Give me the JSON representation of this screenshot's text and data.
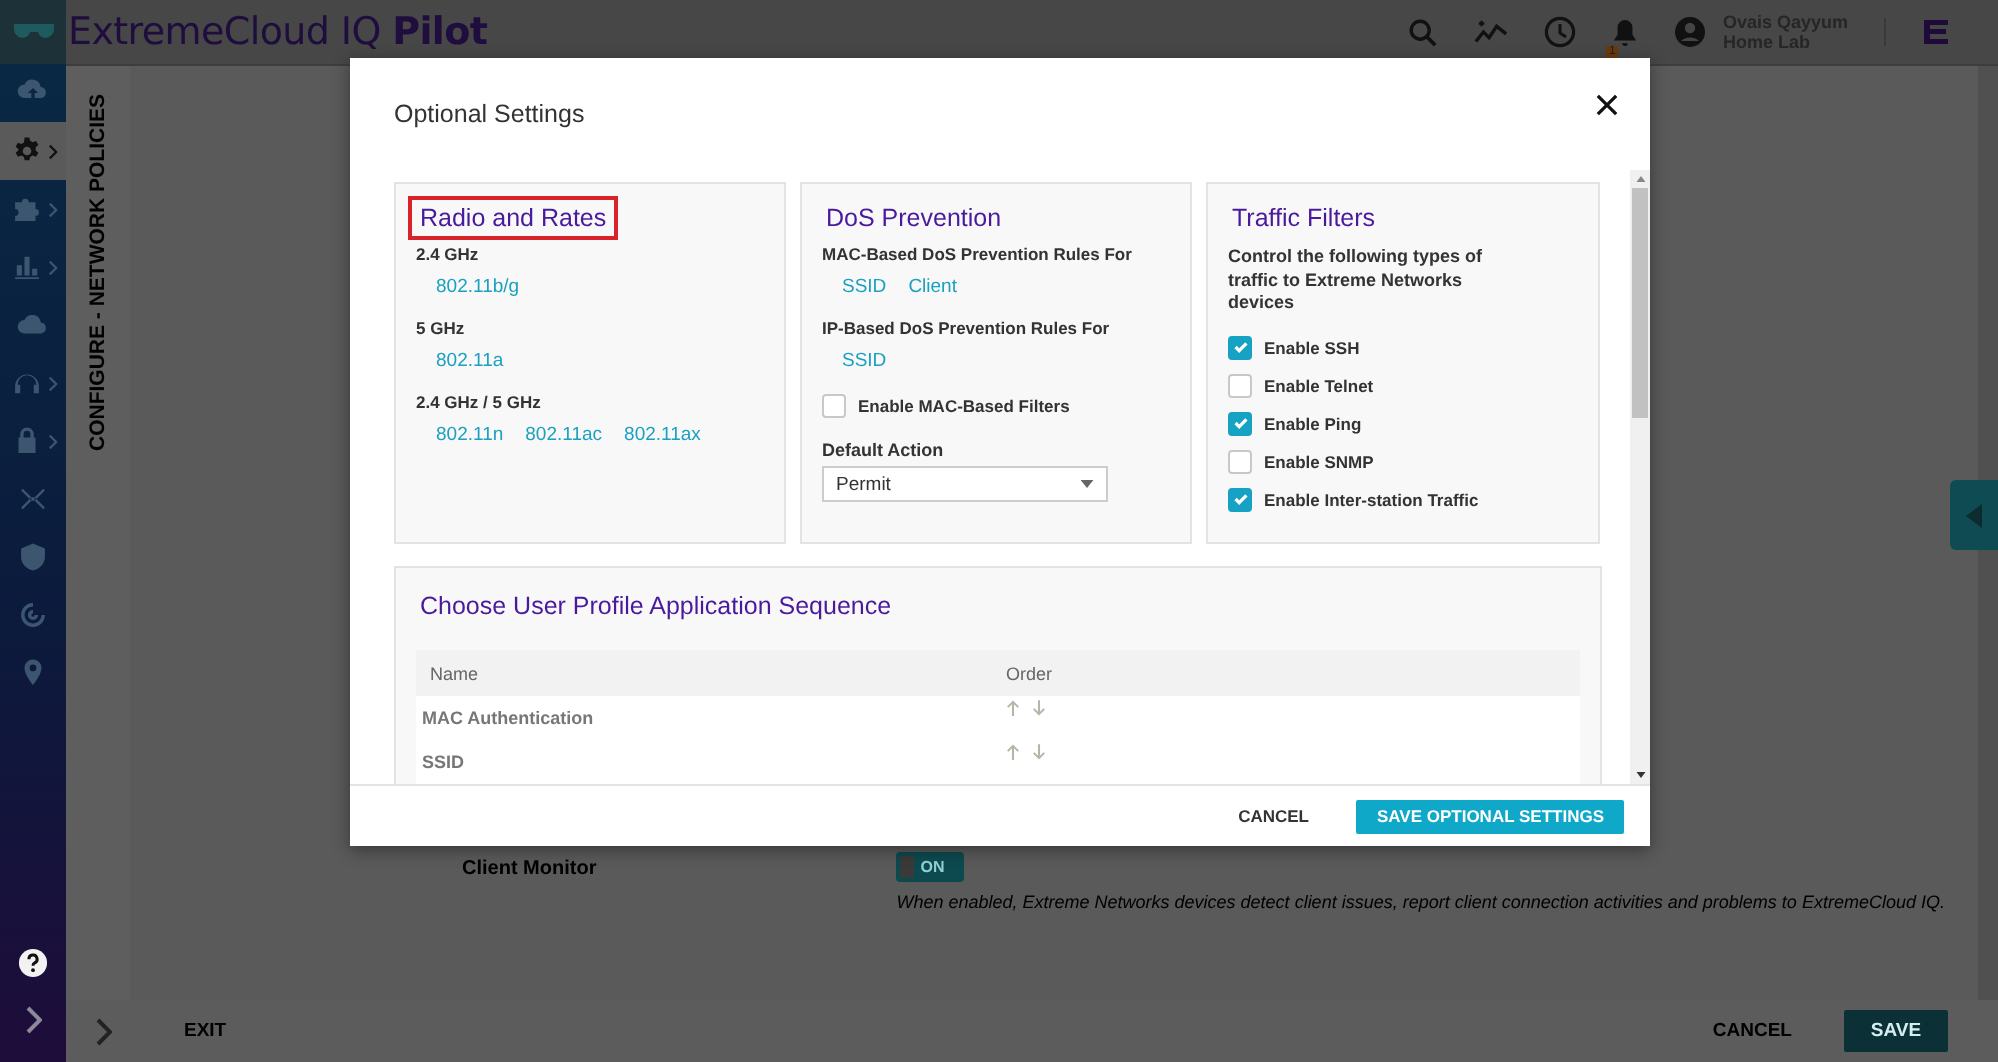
{
  "app": {
    "title": "ExtremeCloud IQ **Pilot**",
    "user": {
      "name": "Ovais Qayyum",
      "org": "Home Lab"
    },
    "notification_count": "1"
  },
  "sidebar": {
    "items": [
      {
        "kind": "cloud-upload",
        "selected": false,
        "submenu": false
      },
      {
        "kind": "gear",
        "selected": true,
        "submenu": true
      },
      {
        "kind": "puzzle",
        "selected": false,
        "submenu": true
      },
      {
        "kind": "chart",
        "selected": false,
        "submenu": true
      },
      {
        "kind": "cloud",
        "selected": false,
        "submenu": false
      },
      {
        "kind": "headset",
        "selected": false,
        "submenu": true
      },
      {
        "kind": "lock",
        "selected": false,
        "submenu": true
      },
      {
        "kind": "network",
        "selected": false,
        "submenu": false
      },
      {
        "kind": "shield",
        "selected": false,
        "submenu": false
      },
      {
        "kind": "radar",
        "selected": false,
        "submenu": false
      },
      {
        "kind": "pin",
        "selected": false,
        "submenu": false
      }
    ]
  },
  "breadcrumb": "CONFIGURE - NETWORK POLICIES",
  "page": {
    "client_monitor": {
      "label": "Client Monitor",
      "toggle": "ON",
      "on": true,
      "hint": "When enabled, Extreme Networks devices detect client issues, report client connection activities and problems to ExtremeCloud IQ."
    },
    "footer": {
      "exit": "EXIT",
      "cancel": "CANCEL",
      "save": "SAVE"
    }
  },
  "dialog": {
    "title": "Optional Settings",
    "radio_rates": {
      "title": "Radio and Rates",
      "highlighted": true,
      "bands": [
        {
          "label": "2.4 GHz",
          "rates": [
            "802.11b/g"
          ]
        },
        {
          "label": "5 GHz",
          "rates": [
            "802.11a"
          ]
        },
        {
          "label": "2.4 GHz / 5 GHz",
          "rates": [
            "802.11n",
            "802.11ac",
            "802.11ax"
          ]
        }
      ]
    },
    "dos": {
      "title": "DoS Prevention",
      "rule_groups": [
        {
          "label": "MAC-Based DoS Prevention Rules For",
          "links": [
            "SSID",
            "Client"
          ]
        },
        {
          "label": "IP-Based DoS Prevention Rules For",
          "links": [
            "SSID"
          ]
        }
      ],
      "mac_filters": {
        "label": "Enable MAC-Based Filters",
        "checked": false
      },
      "default_action": {
        "label": "Default Action",
        "value": "Permit"
      }
    },
    "traffic_filters": {
      "title": "Traffic Filters",
      "description": "Control the following types of traffic to Extreme Networks devices",
      "options": [
        {
          "label": "Enable SSH",
          "checked": true
        },
        {
          "label": "Enable Telnet",
          "checked": false
        },
        {
          "label": "Enable Ping",
          "checked": true
        },
        {
          "label": "Enable SNMP",
          "checked": false
        },
        {
          "label": "Enable Inter-station Traffic",
          "checked": true
        }
      ]
    },
    "sequence": {
      "title": "Choose User Profile Application Sequence",
      "columns": [
        "Name",
        "Order"
      ],
      "rows": [
        {
          "name": "MAC Authentication"
        },
        {
          "name": "SSID"
        }
      ]
    },
    "buttons": {
      "cancel": "CANCEL",
      "save": "SAVE OPTIONAL SETTINGS"
    }
  }
}
